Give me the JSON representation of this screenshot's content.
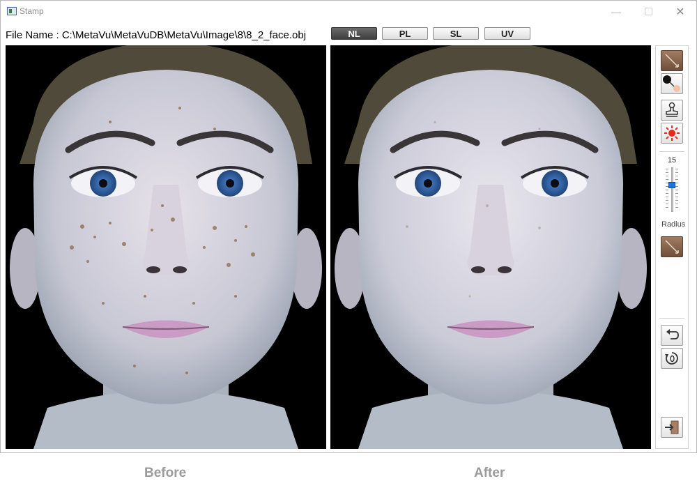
{
  "window": {
    "title": "Stamp",
    "controls": {
      "minimize": "—",
      "close": "✕"
    }
  },
  "file": {
    "label": "File Name : C:\\MetaVu\\MetaVuDB\\MetaVu\\Image\\8\\8_2_face.obj"
  },
  "modes": [
    {
      "label": "NL",
      "active": true
    },
    {
      "label": "PL",
      "active": false
    },
    {
      "label": "SL",
      "active": false
    },
    {
      "label": "UV",
      "active": false
    }
  ],
  "toolbox": {
    "tools": [
      "brush-icon",
      "color-picker-icon",
      "stamp-icon",
      "sun-icon"
    ],
    "radius_value": "15",
    "radius_fraction": 0.3,
    "radius_label": "Radius",
    "tool2": "brush-icon",
    "undo": "undo-icon",
    "reset": "reset-icon",
    "exit": "exit-icon"
  },
  "captions": {
    "before": "Before",
    "after": "After"
  },
  "colors": {
    "active_mode": "#4a4a4a",
    "slider_thumb": "#1a73e8",
    "caption": "#9a9a9a"
  }
}
